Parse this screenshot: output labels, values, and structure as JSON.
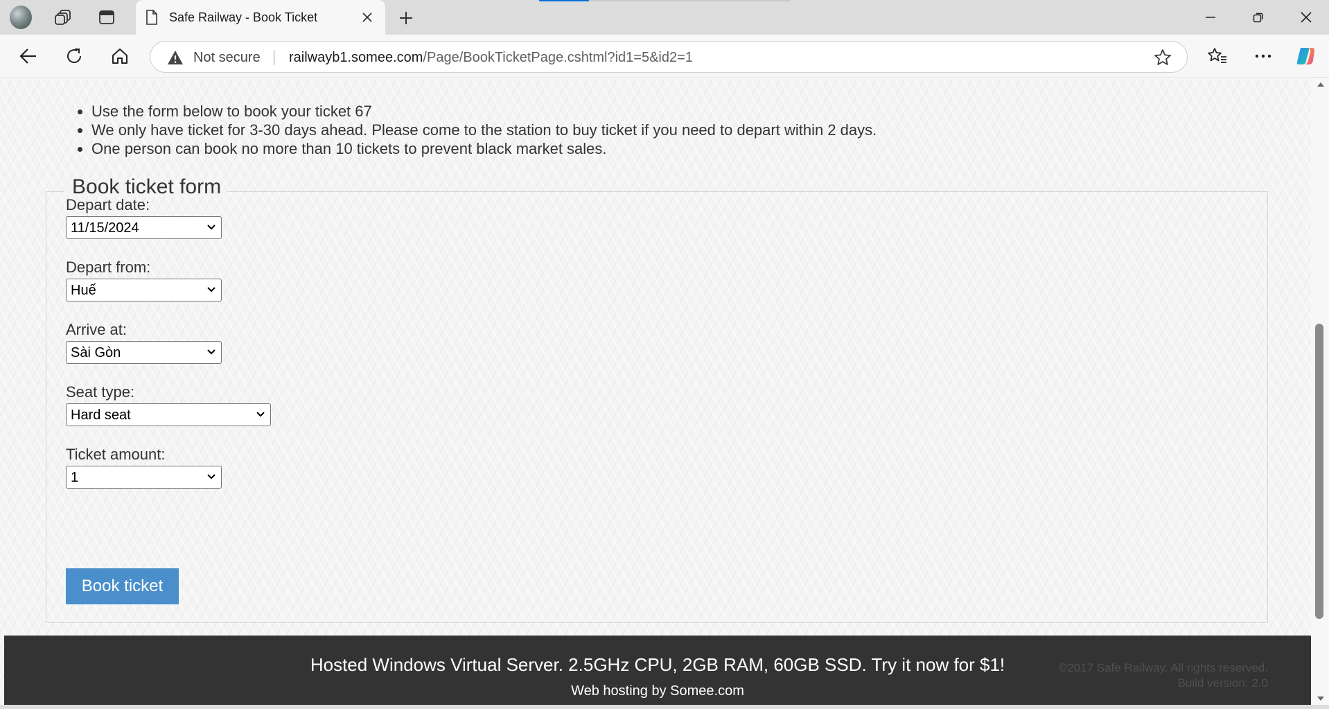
{
  "browser": {
    "tab_title": "Safe Railway - Book Ticket",
    "security_label": "Not secure",
    "url_host": "railwayb1.somee.com",
    "url_path": "/Page/BookTicketPage.cshtml?id1=5&id2=1"
  },
  "notes": [
    "Use the form below to book your ticket 67",
    "We only have ticket for 3-30 days ahead. Please come to the station to buy ticket if you need to depart within 2 days.",
    "One person can book no more than 10 tickets to prevent black market sales."
  ],
  "form": {
    "legend": "Book ticket form",
    "depart_date": {
      "label": "Depart date:",
      "value": "11/15/2024"
    },
    "depart_from": {
      "label": "Depart from:",
      "value": "Huế"
    },
    "arrive_at": {
      "label": "Arrive at:",
      "value": "Sài Gòn"
    },
    "seat_type": {
      "label": "Seat type:",
      "value": "Hard seat"
    },
    "ticket_amount": {
      "label": "Ticket amount:",
      "value": "1"
    },
    "submit_label": "Book ticket"
  },
  "footer": {
    "ad_text": "Hosted Windows Virtual Server. 2.5GHz CPU, 2GB RAM, 60GB SSD. Try it now for $1!",
    "hosting_text": "Web hosting by Somee.com",
    "copyright": "©2017 Safe Railway. All rights reserved.",
    "build_version": "Build version: 2.0"
  },
  "colors": {
    "button": "#4a8fcb",
    "footer_bg": "#333333",
    "accent_loading": "#0a6fd6"
  },
  "icons": [
    "profile-icon",
    "workspaces-icon",
    "vertical-tabs-icon",
    "page-icon",
    "close-icon",
    "plus-icon",
    "back-icon",
    "reload-icon",
    "home-icon",
    "warning-icon",
    "star-icon",
    "favorites-icon",
    "more-icon",
    "copilot-icon"
  ]
}
